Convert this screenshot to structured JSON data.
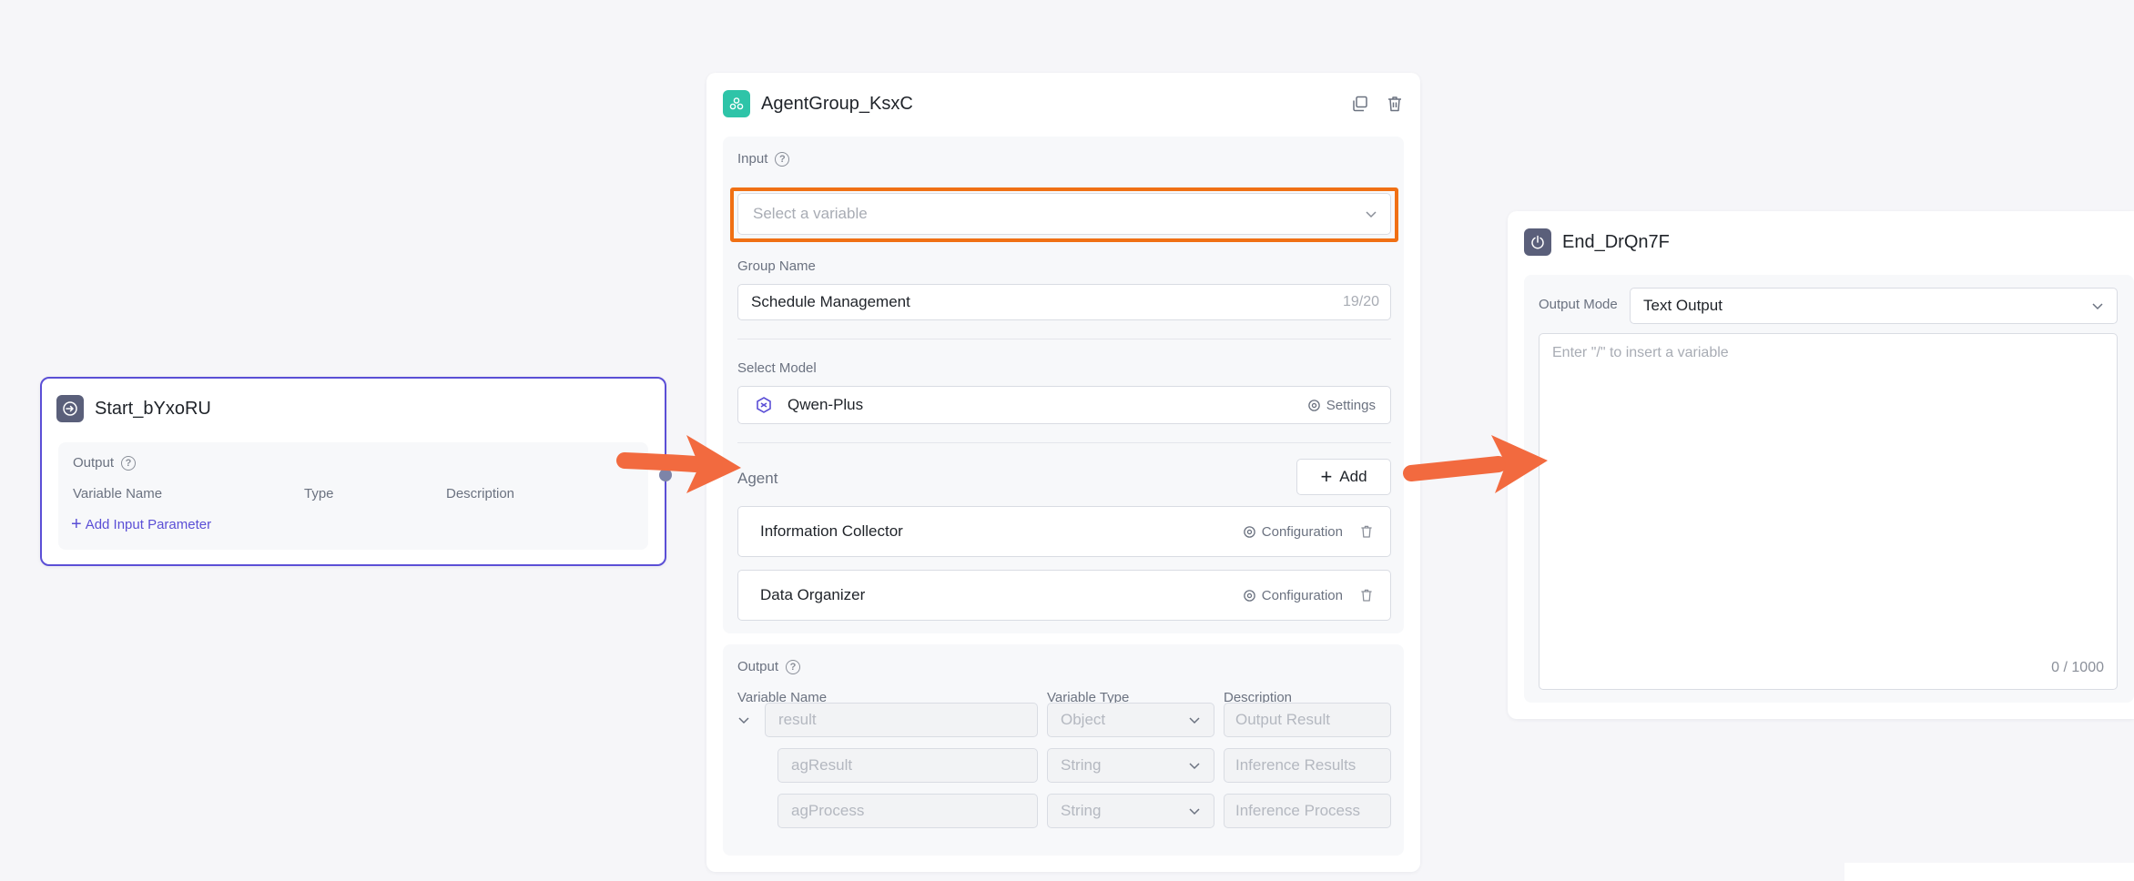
{
  "start_node": {
    "title": "Start_bYxoRU",
    "output_label": "Output",
    "columns": [
      "Variable Name",
      "Type",
      "Description"
    ],
    "add_param": "Add Input Parameter"
  },
  "agent_node": {
    "title": "AgentGroup_KsxC",
    "input_label": "Input",
    "input_placeholder": "Select a variable",
    "group_name_label": "Group Name",
    "group_name_value": "Schedule Management",
    "group_name_count": "19/20",
    "select_model_label": "Select Model",
    "model_name": "Qwen-Plus",
    "settings_label": "Settings",
    "agent_label": "Agent",
    "add_label": "Add",
    "agents": [
      {
        "name": "Information Collector",
        "config": "Configuration"
      },
      {
        "name": "Data Organizer",
        "config": "Configuration"
      }
    ],
    "output_label": "Output",
    "output_columns": [
      "Variable Name",
      "Variable Type",
      "Description"
    ],
    "outputs": [
      {
        "name": "result",
        "type": "Object",
        "desc": "Output Result"
      },
      {
        "name": "agResult",
        "type": "String",
        "desc": "Inference Results"
      },
      {
        "name": "agProcess",
        "type": "String",
        "desc": "Inference Process"
      }
    ]
  },
  "end_node": {
    "title": "End_DrQn7F",
    "output_mode_label": "Output Mode",
    "output_mode_value": "Text Output",
    "textarea_placeholder": "Enter \"/\" to insert a variable",
    "char_count": "0 / 1000"
  },
  "colors": {
    "accent": "#5b4fd6",
    "agent_icon": "#2ec4a8",
    "node_icon": "#5a5f7a",
    "highlight": "#f07014",
    "arrow": "#f26a3f"
  }
}
